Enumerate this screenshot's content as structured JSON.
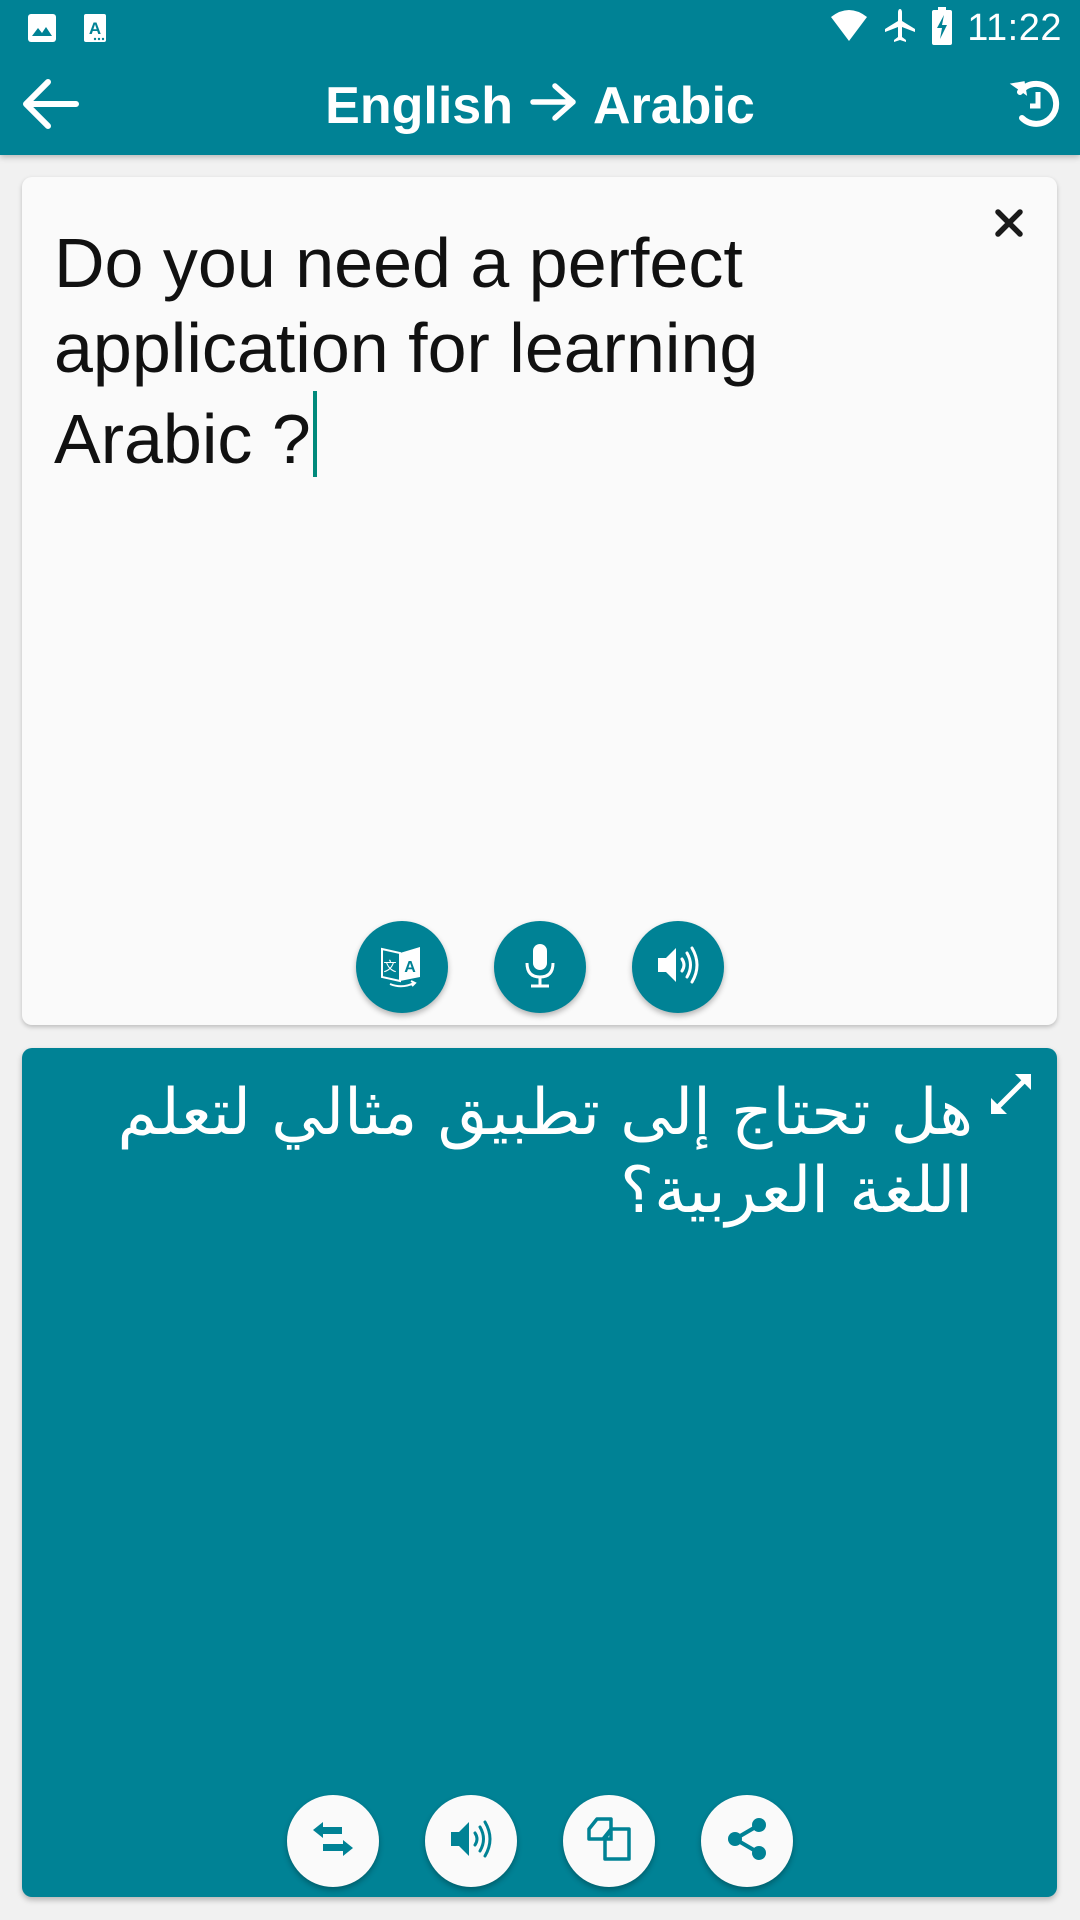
{
  "status_bar": {
    "time": "11:22",
    "left_icons": [
      "image-notification-icon",
      "translate-notification-icon"
    ],
    "right_icons": [
      "wifi-icon",
      "airplane-mode-icon",
      "battery-charging-icon"
    ]
  },
  "toolbar": {
    "source_language": "English",
    "target_language": "Arabic",
    "back_icon": "arrow-back-icon",
    "history_icon": "history-icon"
  },
  "input_card": {
    "text": "Do you need a perfect\napplication for learning\nArabic ?",
    "clear_icon": "close-icon",
    "actions": [
      {
        "name": "translate",
        "icon": "translate-icon"
      },
      {
        "name": "voice-input",
        "icon": "microphone-icon"
      },
      {
        "name": "speak-source",
        "icon": "speaker-icon"
      }
    ]
  },
  "output_card": {
    "text": "هل تحتاج إلى تطبيق مثالي لتعلم اللغة العربية؟",
    "expand_icon": "expand-icon",
    "actions": [
      {
        "name": "swap-languages",
        "icon": "swap-icon"
      },
      {
        "name": "speak-translation",
        "icon": "speaker-icon"
      },
      {
        "name": "copy",
        "icon": "copy-icon"
      },
      {
        "name": "share",
        "icon": "share-icon"
      }
    ]
  },
  "colors": {
    "primary": "#008295",
    "background": "#f1f1f1",
    "card": "#fafafa",
    "caret": "#00897b"
  }
}
